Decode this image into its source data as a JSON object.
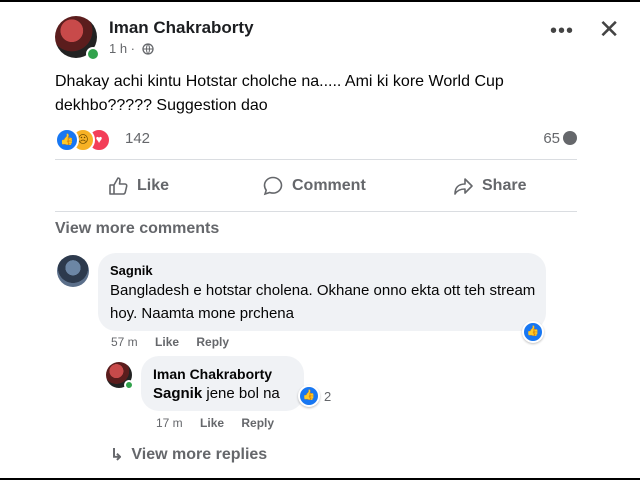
{
  "post": {
    "author": "Iman Chakraborty",
    "time": "1 h ·",
    "text": "Dhakay achi kintu Hotstar cholche na..... Ami ki kore World Cup dekhbo????? Suggestion dao",
    "more_label": "•••",
    "close_label": "✕"
  },
  "reactions": {
    "types": [
      "like-icon",
      "sad-icon",
      "love-icon"
    ],
    "count": "142",
    "comments_count": "65"
  },
  "actions": {
    "like": "Like",
    "comment": "Comment",
    "share": "Share"
  },
  "comments": {
    "view_more": "View more comments",
    "items": [
      {
        "author": "Sagnik",
        "text": "Bangladesh e hotstar cholena. Okhane onno ekta ott teh stream hoy. Naamta mone prchena",
        "time": "57 m",
        "like": "Like",
        "reply": "Reply"
      }
    ],
    "reply": {
      "author": "Iman Chakraborty",
      "mention": "Sagnik",
      "text": " jene bol na",
      "reaction_count": "2",
      "time": "17 m",
      "like": "Like",
      "reply": "Reply"
    },
    "view_more_replies": "View more replies"
  },
  "colors": {
    "brand": "#1877f2",
    "secondary_text": "#65676b",
    "bubble": "#f0f2f5",
    "online": "#31a24c"
  }
}
